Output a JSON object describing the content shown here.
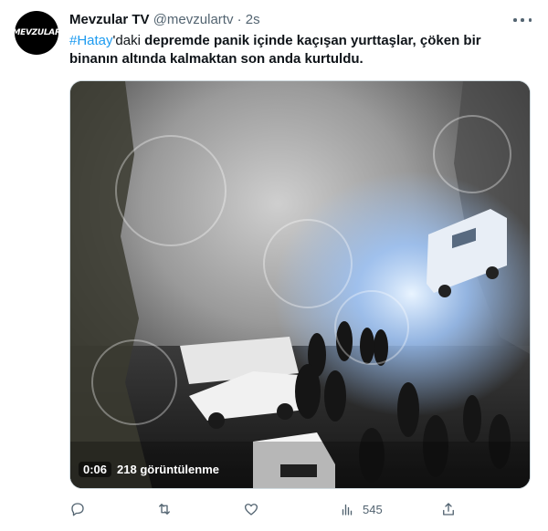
{
  "author": {
    "avatar_text": "MEVZULAR",
    "name": "Mevzular TV",
    "handle": "@mevzulartv",
    "separator": "·",
    "time": "2s"
  },
  "tweet": {
    "hashtag": "#Hatay",
    "text_normal": "'daki",
    "text_bold": " depremde panik içinde kaçışan yurttaşlar, çöken bir binanın altında kalmaktan son anda kurtuldu."
  },
  "video": {
    "duration": "0:06",
    "views": "218 görüntülenme"
  },
  "actions": {
    "reply_icon": "reply-icon",
    "retweet_icon": "retweet-icon",
    "like_icon": "like-icon",
    "views_icon": "views-icon",
    "views_count": "545",
    "share_icon": "share-icon"
  },
  "colors": {
    "accent": "#1d9bf0",
    "secondary_text": "#536471",
    "primary_text": "#0f1419"
  }
}
